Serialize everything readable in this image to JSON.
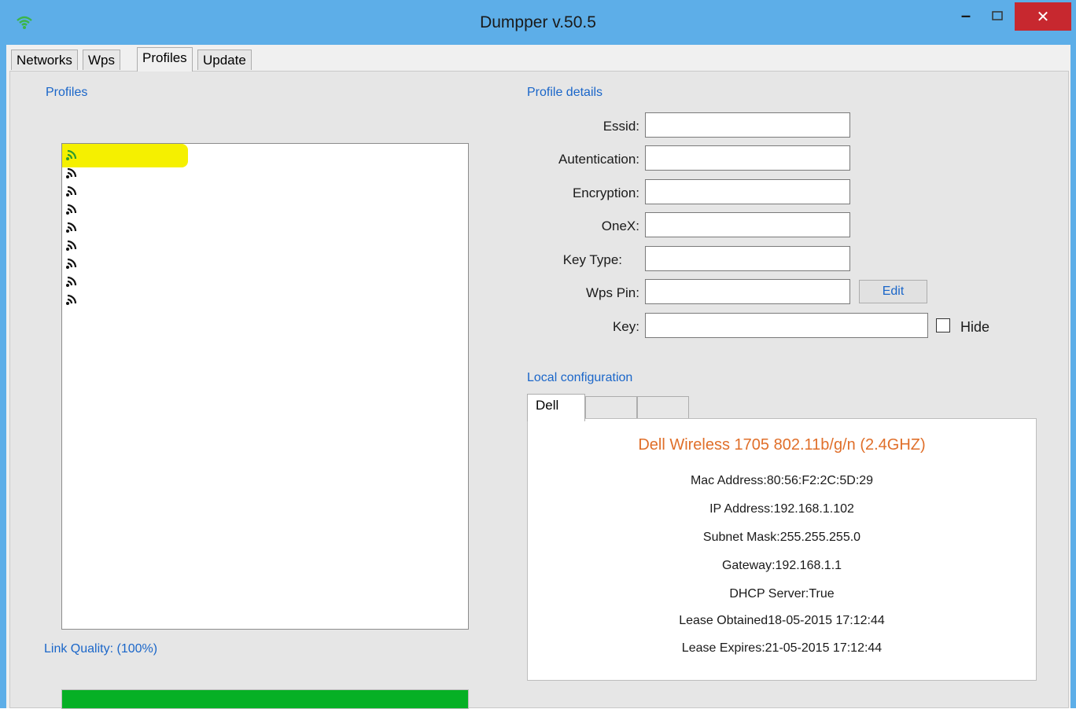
{
  "window": {
    "title": "Dumpper v.50.5"
  },
  "tabs": [
    "Networks",
    "Wps",
    "Profiles",
    "Update"
  ],
  "active_tab": "Profiles",
  "profiles": {
    "label": "Profiles",
    "items": [
      {
        "name": "",
        "highlighted": true
      },
      {
        "name": ""
      },
      {
        "name": ""
      },
      {
        "name": ""
      },
      {
        "name": ""
      },
      {
        "name": ""
      },
      {
        "name": ""
      },
      {
        "name": ""
      },
      {
        "name": ""
      }
    ]
  },
  "link_quality": {
    "label": "Link Quality: (100%)",
    "value": 1.0
  },
  "details": {
    "label": "Profile details",
    "essid": {
      "label": "Essid:",
      "value": ""
    },
    "auth": {
      "label": "Autentication:",
      "value": ""
    },
    "encryption": {
      "label": "Encryption:",
      "value": ""
    },
    "onex": {
      "label": "OneX:",
      "value": ""
    },
    "keytype": {
      "label": "Key Type:",
      "value": ""
    },
    "wpspin": {
      "label": "Wps Pin:",
      "value": ""
    },
    "edit_label": "Edit",
    "key": {
      "label": "Key:",
      "value": ""
    },
    "hide_label": "Hide"
  },
  "local": {
    "label": "Local configuration",
    "tabs": [
      "Dell",
      "",
      ""
    ],
    "device": "Dell Wireless 1705 802.11b/g/n (2.4GHZ)",
    "mac": "Mac Address:80:56:F2:2C:5D:29",
    "ip": "IP Address:192.168.1.102",
    "subnet": "Subnet Mask:255.255.255.0",
    "gateway": "Gateway:192.168.1.1",
    "dhcp": "DHCP Server:True",
    "lease_obtained": "Lease Obtained18-05-2015 17:12:44",
    "lease_expires": "Lease Expires:21-05-2015 17:12:44"
  },
  "colors": {
    "accent": "#1a66c9",
    "progress": "#06b025",
    "device": "#e06f2a",
    "close": "#c7282f",
    "titlebar": "#5daee8"
  }
}
